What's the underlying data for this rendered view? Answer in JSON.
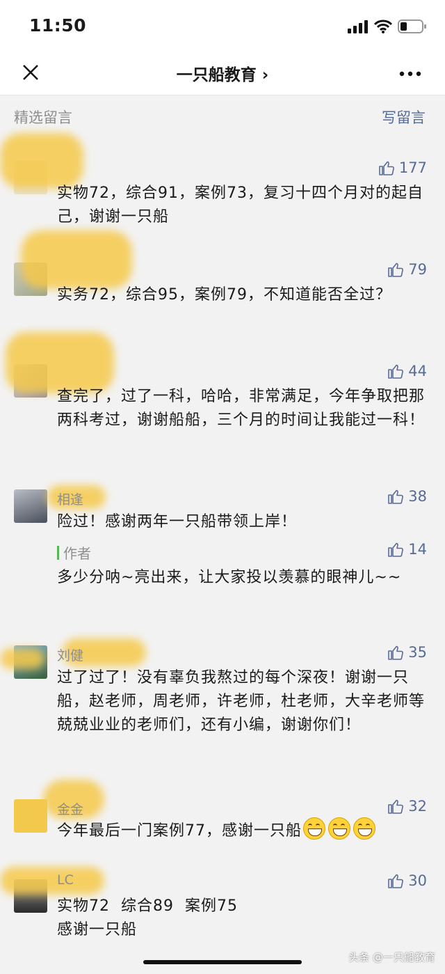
{
  "status_bar": {
    "time": "11:50"
  },
  "nav": {
    "title": "一只船教育 ›"
  },
  "section": {
    "title": "精选留言",
    "write_label": "写留言"
  },
  "comments": [
    {
      "nickname": "",
      "likes": "177",
      "text": "实物72，综合91，案例73，复习十四个月对的起自己，谢谢一只船"
    },
    {
      "nickname": "",
      "likes": "79",
      "text": "实务72，综合95，案例79，不知道能否全过？"
    },
    {
      "nickname": "",
      "likes": "44",
      "text": "查完了，过了一科，哈哈，非常满足，今年争取把那两科考过，谢谢船船，三个月的时间让我能过一科！"
    },
    {
      "nickname": "相逢",
      "likes": "38",
      "text": "险过！感谢两年一只船带领上岸！",
      "reply": {
        "author_label": "作者",
        "likes": "14",
        "text": "多少分呐~亮出来，让大家投以羡慕的眼神儿~~"
      }
    },
    {
      "nickname": "刘健",
      "likes": "35",
      "text": "过了过了！没有辜负我熬过的每个深夜！谢谢一只船，赵老师，周老师，许老师，杜老师，大辛老师等兢兢业业的老师们，还有小编，谢谢你们！"
    },
    {
      "nickname": "金金",
      "likes": "32",
      "text": "今年最后一门案例77，感谢一只船"
    },
    {
      "nickname": "LC",
      "likes": "30",
      "text_line1": "实物72  综合89  案例75",
      "text_line2": "感谢一只船"
    }
  ],
  "watermark": "头条 @一只船教育",
  "colors": {
    "link": "#576b95",
    "background": "#f2f2f2",
    "author_bar": "#5ab45a"
  },
  "icons": [
    "close-icon",
    "more-icon",
    "thumb-up-icon",
    "signal-icon",
    "wifi-icon",
    "battery-icon",
    "grin-emoji-icon"
  ]
}
